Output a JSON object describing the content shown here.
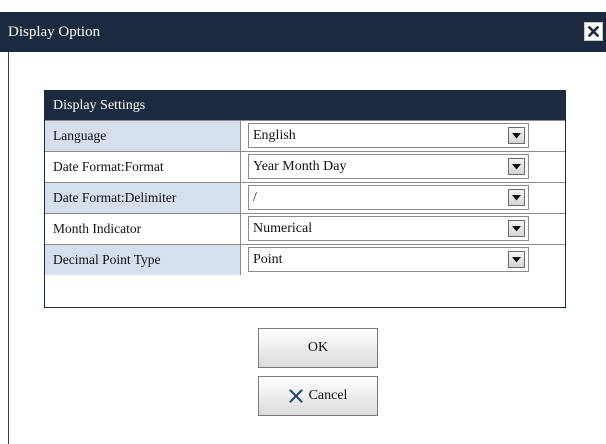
{
  "dialog": {
    "title": "Display Option",
    "close_icon": "close-x-icon"
  },
  "settings": {
    "header": "Display Settings",
    "rows": [
      {
        "label": "Language",
        "value": "English",
        "shaded": true
      },
      {
        "label": "Date Format:Format",
        "value": "Year Month Day",
        "shaded": false
      },
      {
        "label": "Date Format:Delimiter",
        "value": "/",
        "shaded": true
      },
      {
        "label": "Month Indicator",
        "value": "Numerical",
        "shaded": false
      },
      {
        "label": "Decimal Point Type",
        "value": "Point",
        "shaded": true
      }
    ]
  },
  "buttons": {
    "ok_label": "OK",
    "cancel_label": "Cancel",
    "cancel_icon": "x-icon"
  },
  "colors": {
    "titlebar": "#1b2a3e",
    "label_shade": "#d5e0ec"
  }
}
